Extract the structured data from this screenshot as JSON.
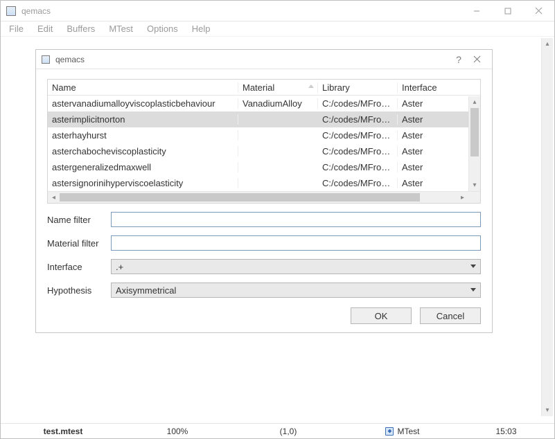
{
  "window": {
    "title": "qemacs",
    "menus": [
      "File",
      "Edit",
      "Buffers",
      "MTest",
      "Options",
      "Help"
    ]
  },
  "statusbar": {
    "file": "test.mtest",
    "zoom": "100%",
    "pos": "(1,0)",
    "mode": "MTest",
    "time": "15:03"
  },
  "dialog": {
    "title": "qemacs",
    "columns": {
      "name": "Name",
      "material": "Material",
      "library": "Library",
      "interface": "Interface"
    },
    "rows": [
      {
        "name": "astervanadiumalloyviscoplasticbehaviour",
        "material": "VanadiumAlloy",
        "library": "C:/codes/MFron...",
        "interface": "Aster",
        "selected": false
      },
      {
        "name": "asterimplicitnorton",
        "material": "",
        "library": "C:/codes/MFron...",
        "interface": "Aster",
        "selected": true
      },
      {
        "name": "asterhayhurst",
        "material": "",
        "library": "C:/codes/MFron...",
        "interface": "Aster",
        "selected": false
      },
      {
        "name": "asterchabocheviscoplasticity",
        "material": "",
        "library": "C:/codes/MFron...",
        "interface": "Aster",
        "selected": false
      },
      {
        "name": "astergeneralizedmaxwell",
        "material": "",
        "library": "C:/codes/MFron...",
        "interface": "Aster",
        "selected": false
      },
      {
        "name": "astersignorinihyperviscoelasticity",
        "material": "",
        "library": "C:/codes/MFron...",
        "interface": "Aster",
        "selected": false
      }
    ],
    "filters": {
      "name_label": "Name filter",
      "name_value": "",
      "material_label": "Material filter",
      "material_value": "",
      "interface_label": "Interface",
      "interface_value": ".+",
      "hypothesis_label": "Hypothesis",
      "hypothesis_value": "Axisymmetrical"
    },
    "buttons": {
      "ok": "OK",
      "cancel": "Cancel"
    }
  }
}
